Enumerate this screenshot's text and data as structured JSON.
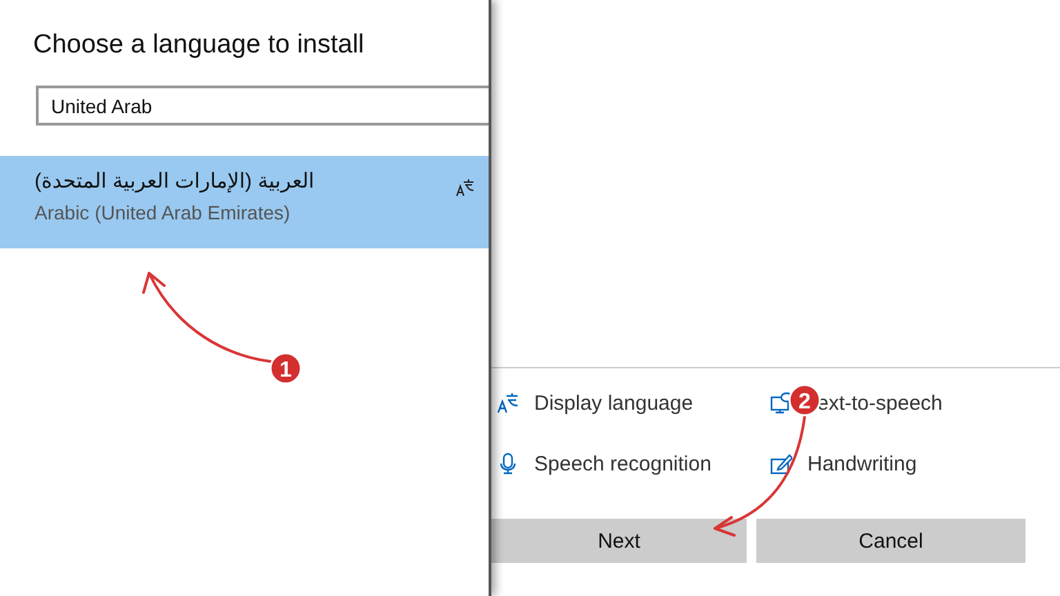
{
  "dialog": {
    "title": "Choose a language to install",
    "search": {
      "value": "United Arab"
    },
    "languages": [
      {
        "native_name": "العربية (الإمارات العربية المتحدة)",
        "english_name": "Arabic (United Arab Emirates)",
        "selected": true,
        "display_language": true
      }
    ]
  },
  "features": [
    {
      "kind": "display-language",
      "label": "Display language"
    },
    {
      "kind": "text-to-speech",
      "label": "ext-to-speech"
    },
    {
      "kind": "speech-recognition",
      "label": "Speech recognition"
    },
    {
      "kind": "handwriting",
      "label": "Handwriting"
    }
  ],
  "buttons": [
    {
      "label": "Next"
    },
    {
      "label": "Cancel"
    }
  ],
  "annotations": [
    {
      "number": "1"
    },
    {
      "number": "2"
    }
  ]
}
